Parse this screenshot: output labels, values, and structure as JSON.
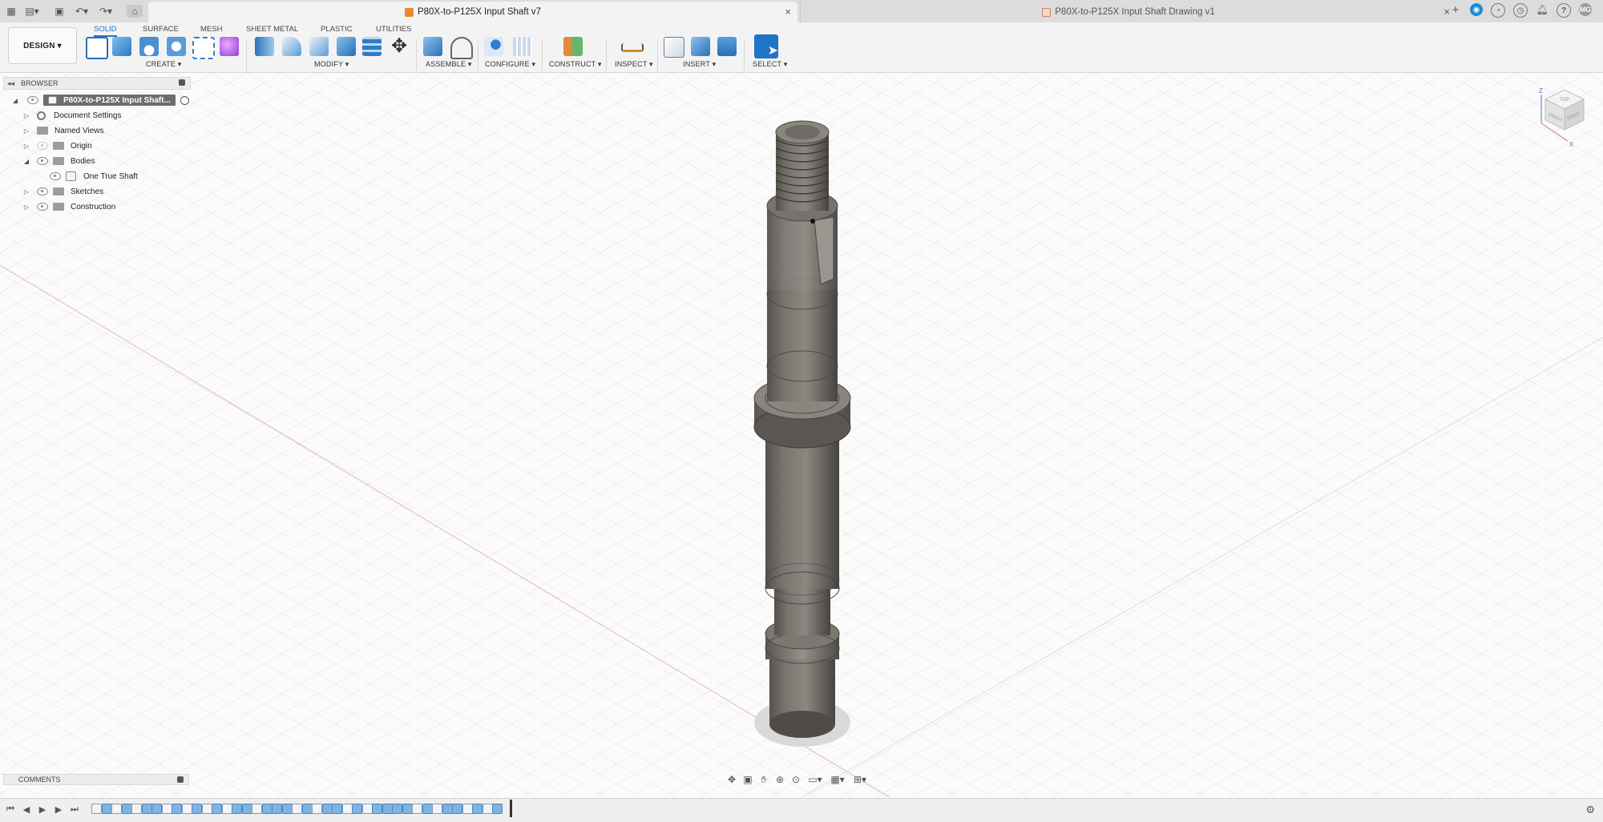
{
  "tabbar": {
    "active_tab_title": "P80X-to-P125X Input Shaft v7",
    "inactive_tab_title": "P80X-to-P125X Input Shaft Drawing v1",
    "close_glyph": "×",
    "add_glyph": "+",
    "user_initials": "MG",
    "help_glyph": "?"
  },
  "toolbar": {
    "workspace_button": "DESIGN ▾",
    "workspace_tabs": [
      "SOLID",
      "SURFACE",
      "MESH",
      "SHEET METAL",
      "PLASTIC",
      "UTILITIES"
    ],
    "groups": [
      "CREATE ▾",
      "MODIFY ▾",
      "ASSEMBLE ▾",
      "CONFIGURE ▾",
      "CONSTRUCT ▾",
      "INSPECT ▾",
      "INSERT ▾",
      "SELECT ▾"
    ],
    "accent": "#1f74c9"
  },
  "browser": {
    "header": "BROWSER",
    "root": "P80X-to-P125X Input Shaft...",
    "items": [
      "Document Settings",
      "Named Views",
      "Origin",
      "Bodies",
      "One True Shaft",
      "Sketches",
      "Construction"
    ]
  },
  "comments": {
    "header": "COMMENTS"
  },
  "viewcube": {
    "top_face": "TOP",
    "front_face": "FRONT",
    "right_face": "RIGHT",
    "axis_z": "Z",
    "axis_x": "X"
  },
  "colors": {
    "shaft_body": "#6e6a65",
    "shaft_shadow": "#4a4743",
    "grid_line": "#e6e6e6",
    "axis_red": "#e9a0a0",
    "axis_green": "#a8d6a8"
  }
}
